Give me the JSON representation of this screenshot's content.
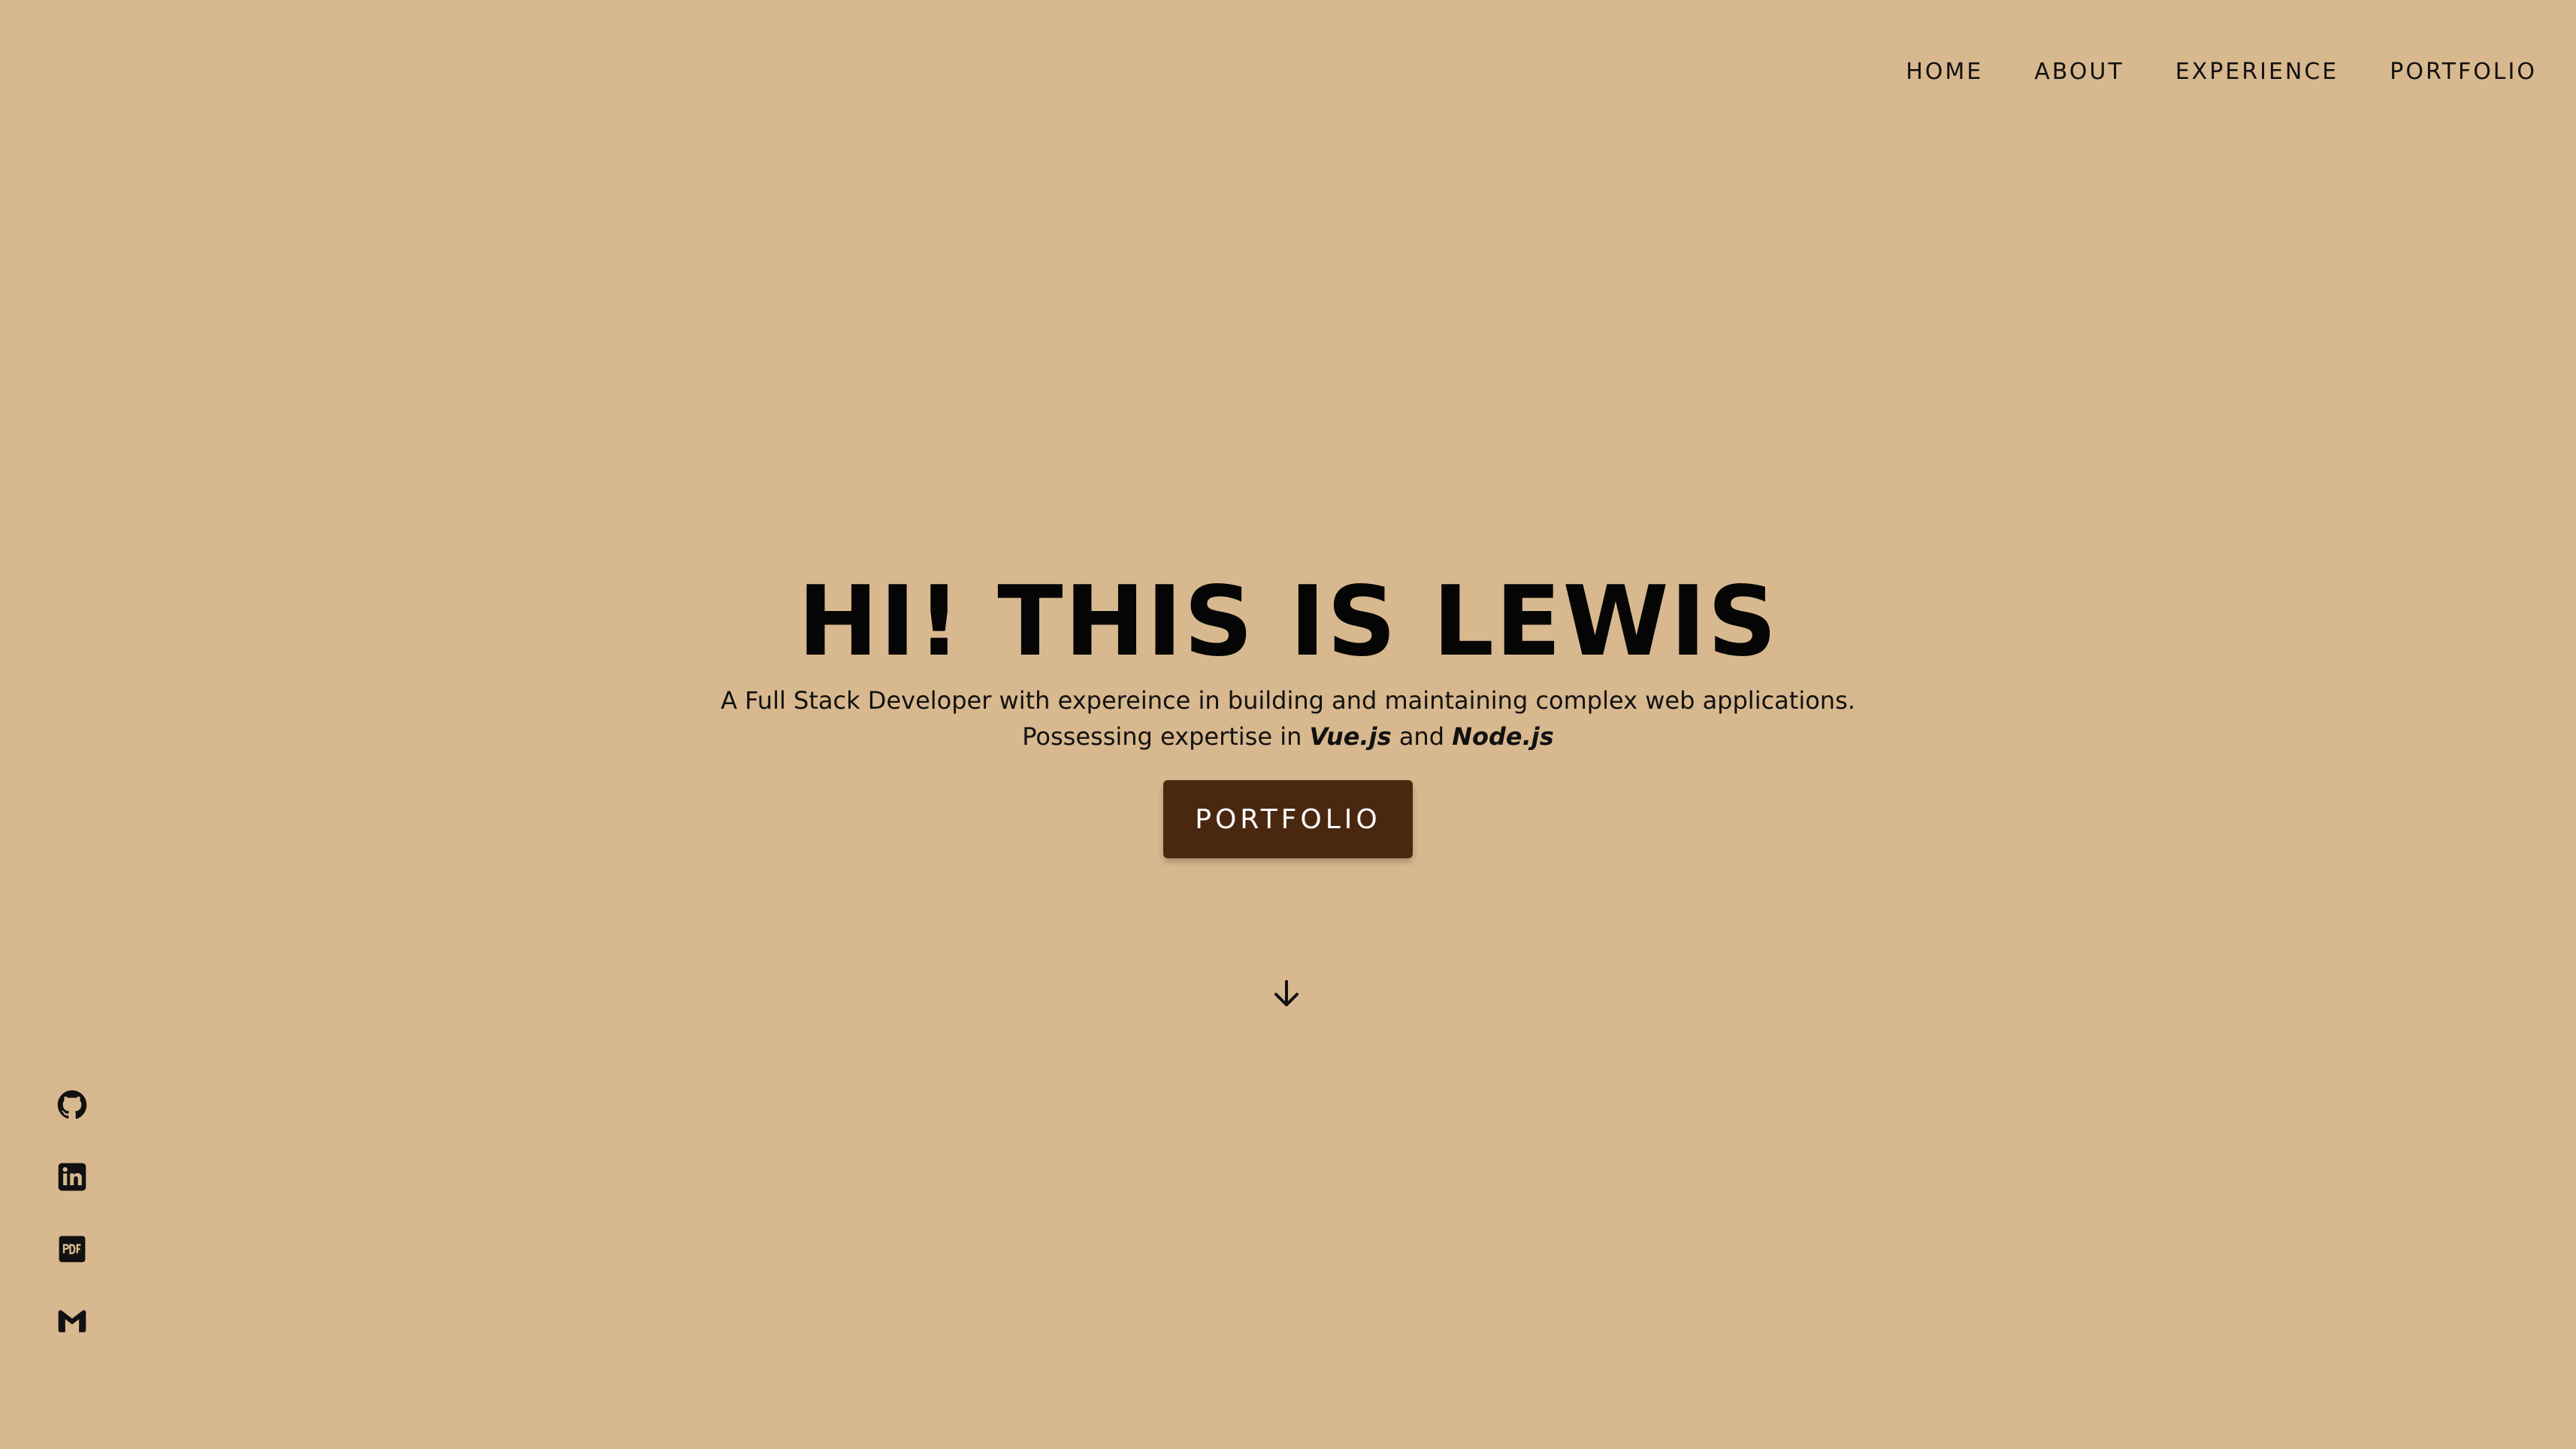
{
  "nav": {
    "items": [
      {
        "label": "HOME"
      },
      {
        "label": "ABOUT"
      },
      {
        "label": "EXPERIENCE"
      },
      {
        "label": "PORTFOLIO"
      }
    ]
  },
  "hero": {
    "title": "HI! THIS IS LEWIS",
    "line1": "A Full Stack Developer with expereince in building and maintaining complex web applications.",
    "line2_prefix": "Possessing expertise in ",
    "skill1": "Vue.js",
    "line2_mid": " and ",
    "skill2": "Node.js",
    "cta_label": "PORTFOLIO"
  },
  "scroll": {
    "icon": "arrow-down-icon"
  },
  "social": {
    "icons": [
      "github-icon",
      "linkedin-icon",
      "pdf-icon",
      "gmail-icon"
    ]
  },
  "colors": {
    "background": "#d8b88e",
    "button": "#4a2810",
    "text": "#111111"
  }
}
